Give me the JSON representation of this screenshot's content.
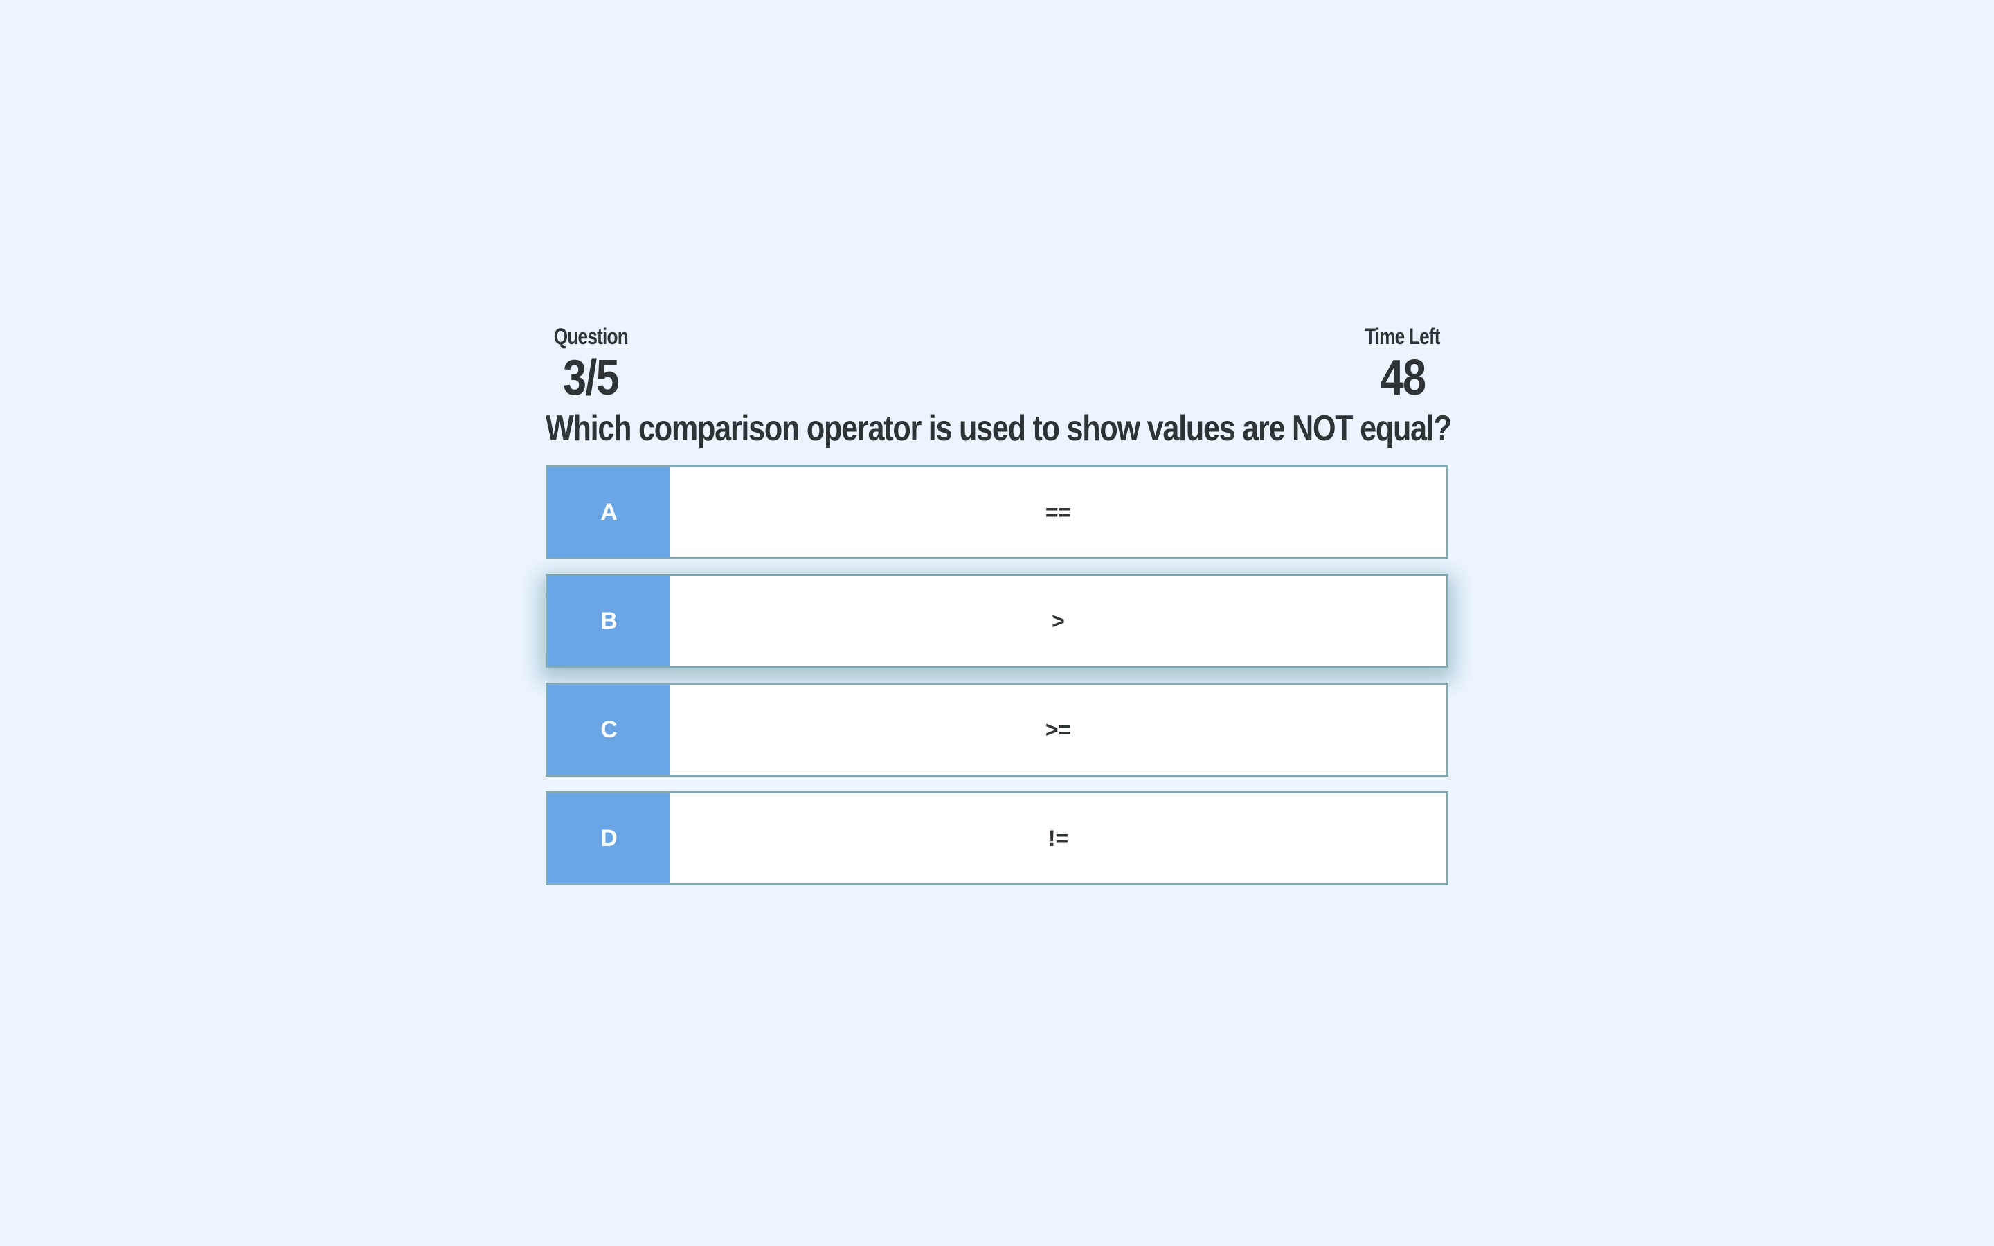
{
  "header": {
    "question_label": "Question",
    "question_progress": "3/5",
    "time_label": "Time Left",
    "time_value": "48"
  },
  "question": {
    "text": "Which comparison operator is used to show values are NOT equal?"
  },
  "answers": [
    {
      "letter": "A",
      "text": "=="
    },
    {
      "letter": "B",
      "text": ">"
    },
    {
      "letter": "C",
      "text": ">="
    },
    {
      "letter": "D",
      "text": "!="
    }
  ],
  "colors": {
    "background": "#ecf4ff",
    "letter_bg": "#6aa5e5",
    "border": "#82a9b4",
    "text": "#2e3336"
  }
}
